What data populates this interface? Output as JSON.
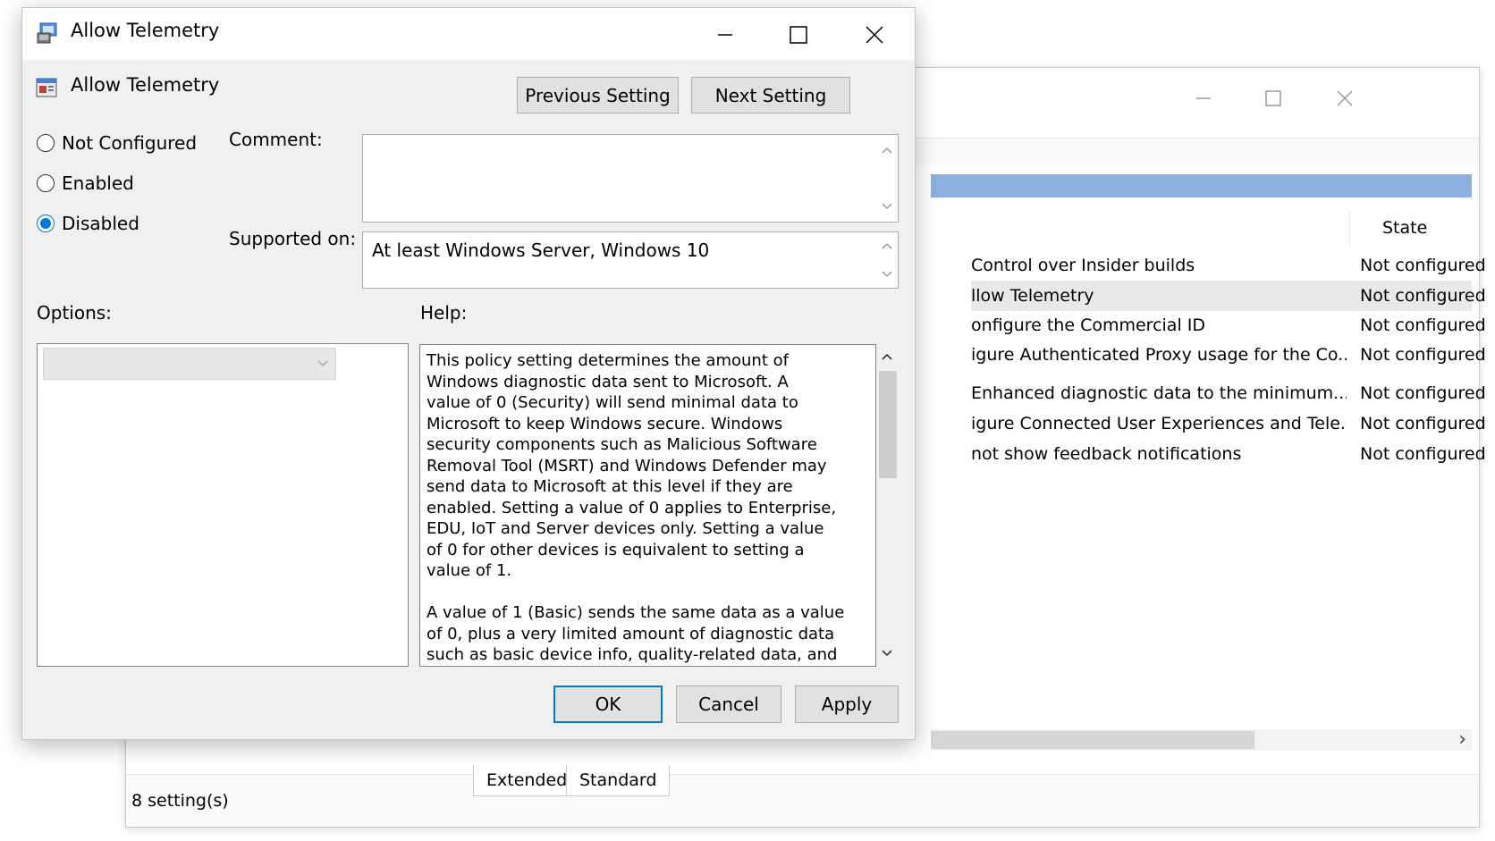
{
  "background_window": {
    "columns": {
      "name": "",
      "state": "State"
    },
    "rows": [
      {
        "name": "Control over Insider builds",
        "state": "Not configured",
        "selected": false
      },
      {
        "name": "llow Telemetry",
        "state": "Not configured",
        "selected": true
      },
      {
        "name": "onfigure the Commercial ID",
        "state": "Not configured",
        "selected": false
      },
      {
        "name": "igure Authenticated Proxy usage for the Co...",
        "state": "Not configured",
        "selected": false
      },
      {
        "name": "Enhanced diagnostic data to the minimum...",
        "state": "Not configured",
        "selected": false
      },
      {
        "name": "igure Connected User Experiences and Tele...",
        "state": "Not configured",
        "selected": false
      },
      {
        "name": "not show feedback notifications",
        "state": "Not configured",
        "selected": false
      }
    ],
    "tabs": [
      "Extended",
      "Standard"
    ],
    "status": "8 setting(s)"
  },
  "dialog": {
    "window_title": "Allow Telemetry",
    "header_title": "Allow Telemetry",
    "previous_setting": "Previous Setting",
    "next_setting": "Next Setting",
    "radios": [
      {
        "label": "Not Configured",
        "checked": false
      },
      {
        "label": "Enabled",
        "checked": false
      },
      {
        "label": "Disabled",
        "checked": true
      }
    ],
    "comment_label": "Comment:",
    "comment_value": "",
    "supported_label": "Supported on:",
    "supported_value": "At least Windows Server, Windows 10",
    "options_label": "Options:",
    "help_label": "Help:",
    "help_text": "This policy setting determines the amount of\nWindows diagnostic data sent to Microsoft. A\nvalue of 0 (Security) will send minimal data to\nMicrosoft to keep Windows secure. Windows\nsecurity components such as Malicious Software\nRemoval Tool (MSRT) and Windows Defender may\nsend data to Microsoft at this level if they are\nenabled. Setting a value of 0 applies to Enterprise,\nEDU, IoT and Server devices only. Setting a value\nof 0 for other devices is equivalent to setting a\nvalue of 1.\n\nA value of 1 (Basic) sends the same data as a value\nof 0, plus a very limited amount of diagnostic data\nsuch as basic device info, quality-related data, and",
    "ok": "OK",
    "cancel": "Cancel",
    "apply": "Apply"
  },
  "icons": [
    "policy-app-icon",
    "policy-setting-icon",
    "minimize-icon",
    "maximize-icon",
    "close-icon",
    "scroll-up-icon",
    "scroll-down-icon",
    "chevron-down-icon",
    "chevron-right-icon"
  ],
  "colors": {
    "accent": "#0078d7",
    "selection_bar": "#8ab0e0",
    "dialog_bg": "#f0f0f0"
  }
}
